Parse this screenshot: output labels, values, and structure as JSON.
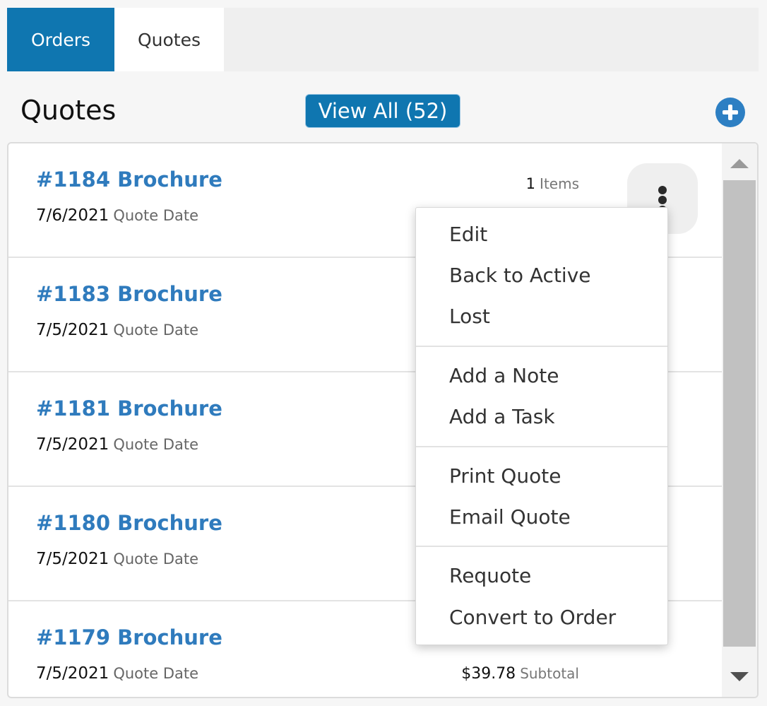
{
  "tabs": [
    {
      "label": "Orders",
      "active": true
    },
    {
      "label": "Quotes",
      "active": false
    }
  ],
  "header": {
    "title": "Quotes",
    "view_all_label": "View All (52)"
  },
  "quotes": [
    {
      "title": "#1184 Brochure",
      "date": "7/6/2021",
      "date_label": "Quote Date",
      "items_count": "1",
      "items_label": "Items"
    },
    {
      "title": "#1183 Brochure",
      "date": "7/5/2021",
      "date_label": "Quote Date"
    },
    {
      "title": "#1181 Brochure",
      "date": "7/5/2021",
      "date_label": "Quote Date"
    },
    {
      "title": "#1180 Brochure",
      "date": "7/5/2021",
      "date_label": "Quote Date"
    },
    {
      "title": "#1179 Brochure",
      "date": "7/5/2021",
      "date_label": "Quote Date",
      "subtotal": "$39.78",
      "subtotal_label": "Subtotal"
    }
  ],
  "menu": {
    "edit": "Edit",
    "back_to_active": "Back to Active",
    "lost": "Lost",
    "add_note": "Add a Note",
    "add_task": "Add a Task",
    "print_quote": "Print Quote",
    "email_quote": "Email Quote",
    "requote": "Requote",
    "convert_to_order": "Convert to Order"
  },
  "icons": {
    "add": "plus-circle-icon",
    "more": "kebab-menu-icon",
    "scroll_up": "triangle-up-icon",
    "scroll_down": "triangle-down-icon"
  },
  "colors": {
    "accent": "#0f76b0",
    "link": "#2f7bbd"
  }
}
